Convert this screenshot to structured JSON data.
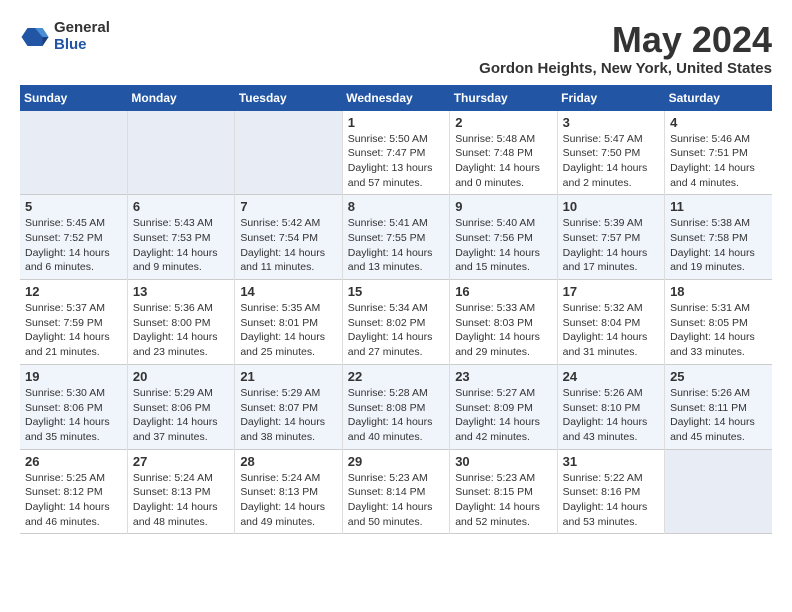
{
  "header": {
    "logo_general": "General",
    "logo_blue": "Blue",
    "title": "May 2024",
    "subtitle": "Gordon Heights, New York, United States"
  },
  "weekdays": [
    "Sunday",
    "Monday",
    "Tuesday",
    "Wednesday",
    "Thursday",
    "Friday",
    "Saturday"
  ],
  "weeks": [
    [
      {
        "num": "",
        "info": ""
      },
      {
        "num": "",
        "info": ""
      },
      {
        "num": "",
        "info": ""
      },
      {
        "num": "1",
        "info": "Sunrise: 5:50 AM\nSunset: 7:47 PM\nDaylight: 13 hours and 57 minutes."
      },
      {
        "num": "2",
        "info": "Sunrise: 5:48 AM\nSunset: 7:48 PM\nDaylight: 14 hours and 0 minutes."
      },
      {
        "num": "3",
        "info": "Sunrise: 5:47 AM\nSunset: 7:50 PM\nDaylight: 14 hours and 2 minutes."
      },
      {
        "num": "4",
        "info": "Sunrise: 5:46 AM\nSunset: 7:51 PM\nDaylight: 14 hours and 4 minutes."
      }
    ],
    [
      {
        "num": "5",
        "info": "Sunrise: 5:45 AM\nSunset: 7:52 PM\nDaylight: 14 hours and 6 minutes."
      },
      {
        "num": "6",
        "info": "Sunrise: 5:43 AM\nSunset: 7:53 PM\nDaylight: 14 hours and 9 minutes."
      },
      {
        "num": "7",
        "info": "Sunrise: 5:42 AM\nSunset: 7:54 PM\nDaylight: 14 hours and 11 minutes."
      },
      {
        "num": "8",
        "info": "Sunrise: 5:41 AM\nSunset: 7:55 PM\nDaylight: 14 hours and 13 minutes."
      },
      {
        "num": "9",
        "info": "Sunrise: 5:40 AM\nSunset: 7:56 PM\nDaylight: 14 hours and 15 minutes."
      },
      {
        "num": "10",
        "info": "Sunrise: 5:39 AM\nSunset: 7:57 PM\nDaylight: 14 hours and 17 minutes."
      },
      {
        "num": "11",
        "info": "Sunrise: 5:38 AM\nSunset: 7:58 PM\nDaylight: 14 hours and 19 minutes."
      }
    ],
    [
      {
        "num": "12",
        "info": "Sunrise: 5:37 AM\nSunset: 7:59 PM\nDaylight: 14 hours and 21 minutes."
      },
      {
        "num": "13",
        "info": "Sunrise: 5:36 AM\nSunset: 8:00 PM\nDaylight: 14 hours and 23 minutes."
      },
      {
        "num": "14",
        "info": "Sunrise: 5:35 AM\nSunset: 8:01 PM\nDaylight: 14 hours and 25 minutes."
      },
      {
        "num": "15",
        "info": "Sunrise: 5:34 AM\nSunset: 8:02 PM\nDaylight: 14 hours and 27 minutes."
      },
      {
        "num": "16",
        "info": "Sunrise: 5:33 AM\nSunset: 8:03 PM\nDaylight: 14 hours and 29 minutes."
      },
      {
        "num": "17",
        "info": "Sunrise: 5:32 AM\nSunset: 8:04 PM\nDaylight: 14 hours and 31 minutes."
      },
      {
        "num": "18",
        "info": "Sunrise: 5:31 AM\nSunset: 8:05 PM\nDaylight: 14 hours and 33 minutes."
      }
    ],
    [
      {
        "num": "19",
        "info": "Sunrise: 5:30 AM\nSunset: 8:06 PM\nDaylight: 14 hours and 35 minutes."
      },
      {
        "num": "20",
        "info": "Sunrise: 5:29 AM\nSunset: 8:06 PM\nDaylight: 14 hours and 37 minutes."
      },
      {
        "num": "21",
        "info": "Sunrise: 5:29 AM\nSunset: 8:07 PM\nDaylight: 14 hours and 38 minutes."
      },
      {
        "num": "22",
        "info": "Sunrise: 5:28 AM\nSunset: 8:08 PM\nDaylight: 14 hours and 40 minutes."
      },
      {
        "num": "23",
        "info": "Sunrise: 5:27 AM\nSunset: 8:09 PM\nDaylight: 14 hours and 42 minutes."
      },
      {
        "num": "24",
        "info": "Sunrise: 5:26 AM\nSunset: 8:10 PM\nDaylight: 14 hours and 43 minutes."
      },
      {
        "num": "25",
        "info": "Sunrise: 5:26 AM\nSunset: 8:11 PM\nDaylight: 14 hours and 45 minutes."
      }
    ],
    [
      {
        "num": "26",
        "info": "Sunrise: 5:25 AM\nSunset: 8:12 PM\nDaylight: 14 hours and 46 minutes."
      },
      {
        "num": "27",
        "info": "Sunrise: 5:24 AM\nSunset: 8:13 PM\nDaylight: 14 hours and 48 minutes."
      },
      {
        "num": "28",
        "info": "Sunrise: 5:24 AM\nSunset: 8:13 PM\nDaylight: 14 hours and 49 minutes."
      },
      {
        "num": "29",
        "info": "Sunrise: 5:23 AM\nSunset: 8:14 PM\nDaylight: 14 hours and 50 minutes."
      },
      {
        "num": "30",
        "info": "Sunrise: 5:23 AM\nSunset: 8:15 PM\nDaylight: 14 hours and 52 minutes."
      },
      {
        "num": "31",
        "info": "Sunrise: 5:22 AM\nSunset: 8:16 PM\nDaylight: 14 hours and 53 minutes."
      },
      {
        "num": "",
        "info": ""
      }
    ]
  ]
}
